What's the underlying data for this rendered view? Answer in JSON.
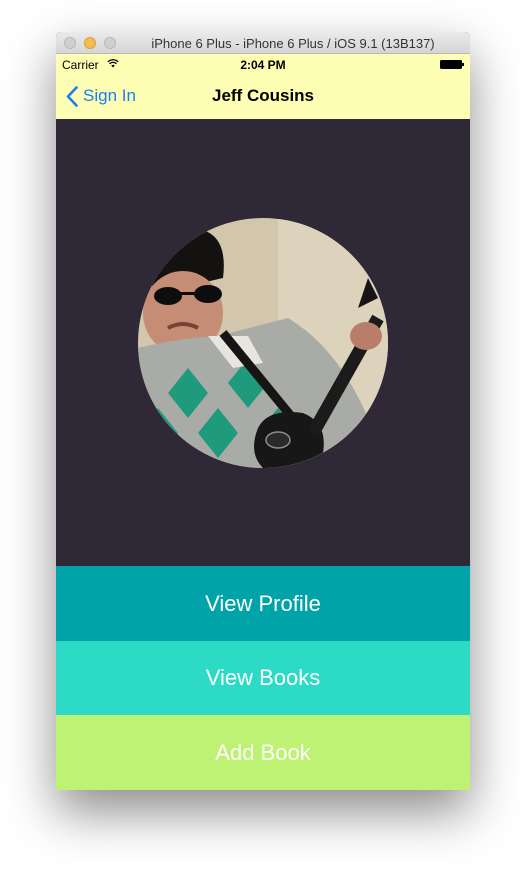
{
  "window": {
    "title": "iPhone 6 Plus - iPhone 6 Plus / iOS 9.1 (13B137)"
  },
  "status_bar": {
    "carrier": "Carrier",
    "time": "2:04 PM",
    "icons": [
      "wifi-icon",
      "battery-icon"
    ]
  },
  "nav_bar": {
    "back_label": "Sign In",
    "title": "Jeff Cousins",
    "background": "#fdfdb3",
    "tint": "#1a7ff5"
  },
  "hero": {
    "background": "#2f2937",
    "image": "profile-photo"
  },
  "actions": [
    {
      "label": "View Profile",
      "color": "#00a3a8"
    },
    {
      "label": "View Books",
      "color": "#2cdac5"
    },
    {
      "label": "Add Book",
      "color": "#bef273"
    }
  ]
}
